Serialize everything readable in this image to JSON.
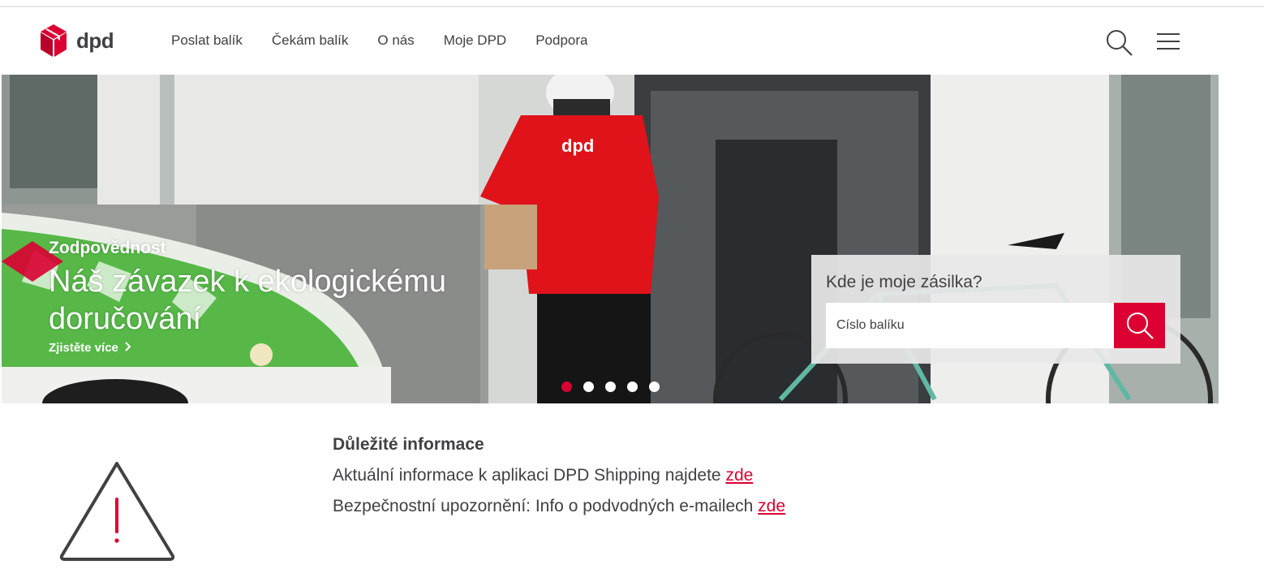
{
  "brand": {
    "name": "dpd",
    "accent_color": "#dc0032",
    "text_color": "#414042"
  },
  "nav": {
    "items": [
      "Poslat balík",
      "Čekám balík",
      "O nás",
      "Moje DPD",
      "Podpora"
    ],
    "search_icon": "search-icon",
    "menu_icon": "hamburger-menu-icon"
  },
  "hero": {
    "kicker": "Zodpovědnost",
    "title": "Náš závazek k ekologickému doručování",
    "link_label": "Zjistěte více",
    "slides_count": 5,
    "active_slide": 1
  },
  "tracking": {
    "title": "Kde je moje zásilka?",
    "placeholder": "Císlo balíku",
    "button_icon": "search-icon"
  },
  "info": {
    "title": "Důležité informace",
    "line1_text": "Aktuální informace k aplikaci DPD Shipping najdete ",
    "line1_link": "zde",
    "line2_text": "Bezpečnostní upozornění: Info o podvodných e-mailech ",
    "line2_link": "zde",
    "icon": "warning-triangle-icon"
  }
}
